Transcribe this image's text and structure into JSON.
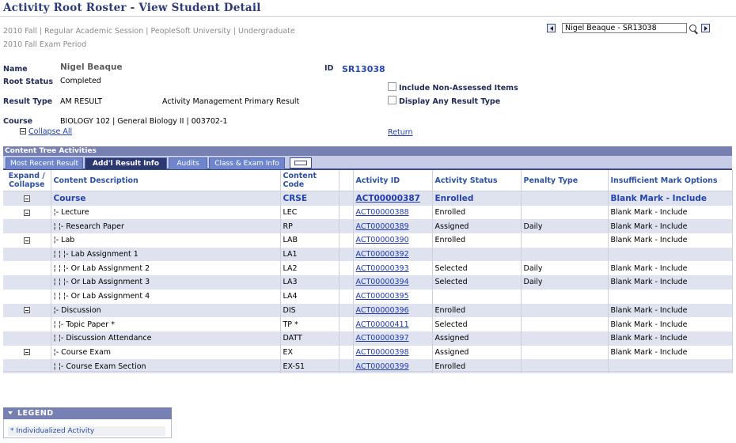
{
  "page": {
    "title": "Activity Root Roster - View Student Detail",
    "context_line1": "2010 Fall | Regular Academic Session | PeopleSoft University | Undergraduate",
    "context_line2": "2010 Fall Exam Period"
  },
  "student_nav": {
    "selected": "Nigel Beaque - SR13038"
  },
  "student": {
    "name_label": "Name",
    "name_value": "Nigel Beaque",
    "id_label": "ID",
    "id_value": "SR13038",
    "root_status_label": "Root Status",
    "root_status_value": "Completed",
    "result_type_label": "Result Type",
    "result_type_value": "AM RESULT",
    "result_type_desc": "Activity Management Primary Result",
    "course_label": "Course",
    "course_value": "BIOLOGY  102  |  General Biology II  |  003702-1",
    "collapse_all": "Collapse All",
    "return_link": "Return"
  },
  "options": {
    "include_non_assessed": "Include Non-Assessed Items",
    "display_any_result_type": "Display Any Result Type"
  },
  "grid": {
    "title": "Content Tree Activities",
    "tabs": [
      "Most Recent Result",
      "Add'l Result Info",
      "Audits",
      "Class & Exam Info"
    ],
    "active_tab": "Add'l Result Info",
    "columns": [
      "Expand / Collapse",
      "Content Description",
      "Content Code",
      "",
      "Activity ID",
      "Activity Status",
      "Penalty Type",
      "Insufficient Mark Options"
    ],
    "rows": [
      {
        "ec": true,
        "desc": "Course",
        "code": "CRSE",
        "activity_id": "ACT00000387",
        "status": "Enrolled",
        "penalty": "",
        "mark": "Blank Mark - Include"
      },
      {
        "ec": true,
        "desc": "¦- Lecture",
        "code": "LEC",
        "activity_id": "ACT00000388",
        "status": "Enrolled",
        "penalty": "",
        "mark": "Blank Mark - Include"
      },
      {
        "ec": false,
        "desc": "¦   ¦- Research Paper",
        "code": "RP",
        "activity_id": "ACT00000389",
        "status": "Assigned",
        "penalty": "Daily",
        "mark": "Blank Mark - Include"
      },
      {
        "ec": true,
        "desc": "¦- Lab",
        "code": "LAB",
        "activity_id": "ACT00000390",
        "status": "Enrolled",
        "penalty": "",
        "mark": "Blank Mark - Include"
      },
      {
        "ec": false,
        "desc": "¦   ¦   ¦- Lab Assignment 1",
        "code": "LA1",
        "activity_id": "ACT00000392",
        "status": "",
        "penalty": "",
        "mark": ""
      },
      {
        "ec": false,
        "desc": "¦   ¦   ¦- Or Lab Assignment 2",
        "code": "LA2",
        "activity_id": "ACT00000393",
        "status": "Selected",
        "penalty": "Daily",
        "mark": "Blank Mark - Include"
      },
      {
        "ec": false,
        "desc": "¦   ¦   ¦- Or Lab Assignment 3",
        "code": "LA3",
        "activity_id": "ACT00000394",
        "status": "Selected",
        "penalty": "Daily",
        "mark": "Blank Mark - Include"
      },
      {
        "ec": false,
        "desc": "¦   ¦   ¦- Or Lab Assignment 4",
        "code": "LA4",
        "activity_id": "ACT00000395",
        "status": "",
        "penalty": "",
        "mark": ""
      },
      {
        "ec": true,
        "desc": "¦- Discussion",
        "code": "DIS",
        "activity_id": "ACT00000396",
        "status": "Enrolled",
        "penalty": "",
        "mark": "Blank Mark - Include"
      },
      {
        "ec": false,
        "desc": "¦   ¦- Topic Paper *",
        "code": "TP *",
        "activity_id": "ACT00000411",
        "status": "Selected",
        "penalty": "",
        "mark": "Blank Mark - Include"
      },
      {
        "ec": false,
        "desc": "¦   ¦- Discussion Attendance",
        "code": "DATT",
        "activity_id": "ACT00000397",
        "status": "Assigned",
        "penalty": "",
        "mark": "Blank Mark - Include"
      },
      {
        "ec": true,
        "desc": "¦- Course Exam",
        "code": "EX",
        "activity_id": "ACT00000398",
        "status": "Assigned",
        "penalty": "",
        "mark": "Blank Mark - Include"
      },
      {
        "ec": false,
        "desc": "¦   ¦- Course Exam Section",
        "code": "EX-S1",
        "activity_id": "ACT00000399",
        "status": "Enrolled",
        "penalty": "",
        "mark": ""
      }
    ]
  },
  "legend": {
    "title": "LEGEND",
    "items": [
      "* Individualized Activity"
    ]
  }
}
